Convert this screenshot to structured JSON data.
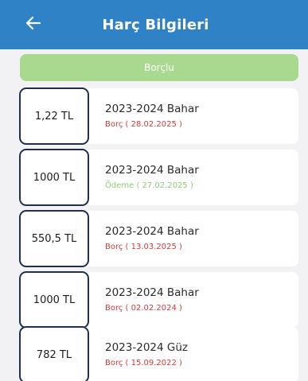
{
  "header": {
    "title": "Harç Bilgileri",
    "back_icon": "arrow-left-icon",
    "background": "#2f82c5"
  },
  "status_bar": {
    "label": "Borçlu",
    "color": "#a8d98f"
  },
  "records": [
    {
      "amount": "1,22 TL",
      "term": "2023-2024 Bahar",
      "status": "Borç ( 28.02.2025 )",
      "type": "borc"
    },
    {
      "amount": "1000 TL",
      "term": "2023-2024 Bahar",
      "status": "Ödeme ( 27.02.2025 )",
      "type": "odeme"
    },
    {
      "amount": "550,5 TL",
      "term": "2023-2024 Bahar",
      "status": "Borç ( 13.03.2025 )",
      "type": "borc"
    },
    {
      "amount": "1000 TL",
      "term": "2023-2024 Bahar",
      "status": "Borç ( 02.02.2024 )",
      "type": "borc"
    },
    {
      "amount": "782 TL",
      "term": "2023-2024 Güz",
      "status": "Borç ( 15.09.2022 )",
      "type": "borc"
    }
  ],
  "colors": {
    "borc": "#d33a3a",
    "odeme": "#8ccc74",
    "amount_border": "#1f2f52"
  }
}
